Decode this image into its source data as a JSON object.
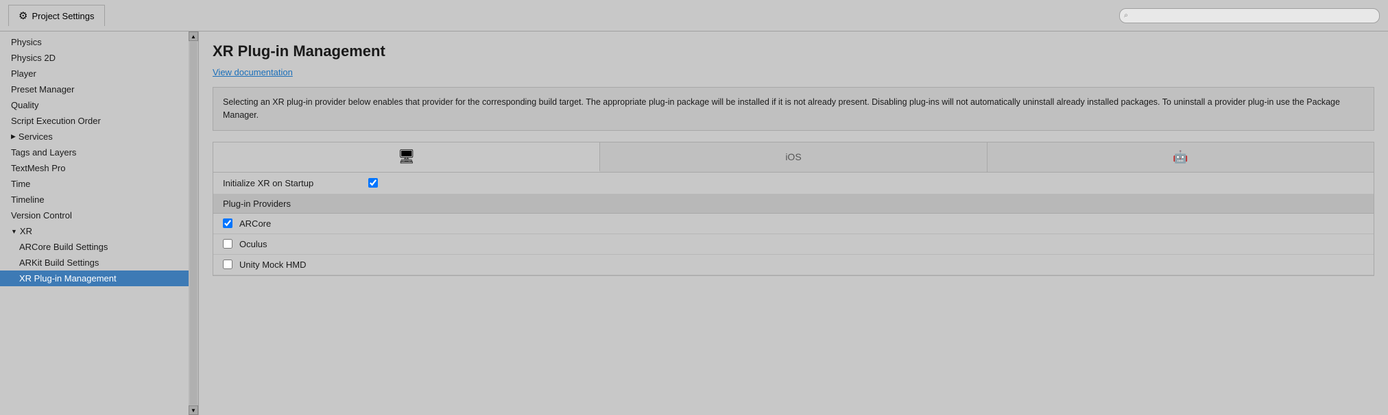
{
  "titleBar": {
    "tabLabel": "Project Settings",
    "gearIcon": "⚙"
  },
  "search": {
    "placeholder": "",
    "icon": "🔍"
  },
  "sidebar": {
    "items": [
      {
        "id": "physics",
        "label": "Physics",
        "indent": false,
        "parent": false,
        "active": false
      },
      {
        "id": "physics2d",
        "label": "Physics 2D",
        "indent": false,
        "parent": false,
        "active": false
      },
      {
        "id": "player",
        "label": "Player",
        "indent": false,
        "parent": false,
        "active": false
      },
      {
        "id": "preset-manager",
        "label": "Preset Manager",
        "indent": false,
        "parent": false,
        "active": false
      },
      {
        "id": "quality",
        "label": "Quality",
        "indent": false,
        "parent": false,
        "active": false
      },
      {
        "id": "script-execution-order",
        "label": "Script Execution Order",
        "indent": false,
        "parent": false,
        "active": false
      },
      {
        "id": "services",
        "label": "Services",
        "indent": false,
        "parent": true,
        "triangle": "▶",
        "active": false
      },
      {
        "id": "tags-and-layers",
        "label": "Tags and Layers",
        "indent": false,
        "parent": false,
        "active": false
      },
      {
        "id": "textmesh-pro",
        "label": "TextMesh Pro",
        "indent": false,
        "parent": false,
        "active": false
      },
      {
        "id": "time",
        "label": "Time",
        "indent": false,
        "parent": false,
        "active": false
      },
      {
        "id": "timeline",
        "label": "Timeline",
        "indent": false,
        "parent": false,
        "active": false
      },
      {
        "id": "version-control",
        "label": "Version Control",
        "indent": false,
        "parent": false,
        "active": false
      },
      {
        "id": "xr",
        "label": "XR",
        "indent": false,
        "parent": true,
        "triangle": "▼",
        "active": false
      },
      {
        "id": "arcore-build-settings",
        "label": "ARCore Build Settings",
        "indent": true,
        "parent": false,
        "active": false
      },
      {
        "id": "arkit-build-settings",
        "label": "ARKit Build Settings",
        "indent": true,
        "parent": false,
        "active": false
      },
      {
        "id": "xr-plugin-management",
        "label": "XR Plug-in Management",
        "indent": true,
        "parent": false,
        "active": true
      }
    ]
  },
  "content": {
    "title": "XR Plug-in Management",
    "docLinkLabel": "View documentation",
    "description": "Selecting an XR plug-in provider below enables that provider for the corresponding build target. The appropriate plug-in package will be installed if it is not already present. Disabling plug-ins will not automatically uninstall already installed packages. To uninstall a provider plug-in use the Package Manager.",
    "tabs": [
      {
        "id": "desktop",
        "label": "",
        "iconType": "monitor",
        "active": true
      },
      {
        "id": "ios",
        "label": "iOS",
        "iconType": "text",
        "active": false
      },
      {
        "id": "android",
        "label": "",
        "iconType": "android",
        "active": false
      }
    ],
    "initXROnStartup": {
      "label": "Initialize XR on Startup",
      "checked": true
    },
    "pluginProviders": {
      "header": "Plug-in Providers",
      "providers": [
        {
          "id": "arcore",
          "label": "ARCore",
          "checked": true
        },
        {
          "id": "oculus",
          "label": "Oculus",
          "checked": false
        },
        {
          "id": "unity-mock-hmd",
          "label": "Unity Mock HMD",
          "checked": false
        }
      ]
    }
  }
}
